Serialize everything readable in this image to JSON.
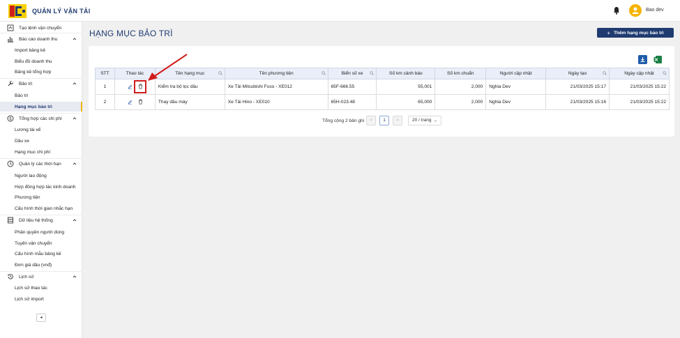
{
  "header": {
    "app_title": "QUẢN LÝ VẬN TẢI",
    "username": "Bao dev"
  },
  "sidebar": {
    "items": [
      {
        "label": "Tạo lệnh vận chuyển"
      },
      {
        "label": "Báo cáo doanh thu"
      },
      {
        "label": "Import bảng kê"
      },
      {
        "label": "Biểu đồ doanh thu"
      },
      {
        "label": "Bảng kê tổng hợp"
      },
      {
        "label": "Bảo trì"
      },
      {
        "label": "Bảo trì"
      },
      {
        "label": "Hạng mục bảo trì"
      },
      {
        "label": "Tổng hợp các chi phí"
      },
      {
        "label": "Lương tài xế"
      },
      {
        "label": "Dầu xe"
      },
      {
        "label": "Hạng mục chi phí"
      },
      {
        "label": "Quản lý các thời hạn"
      },
      {
        "label": "Người lao động"
      },
      {
        "label": "Hợp đồng hợp tác kinh doanh"
      },
      {
        "label": "Phương tiện"
      },
      {
        "label": "Cấu hình thời gian nhắc hạn"
      },
      {
        "label": "Dữ liệu hệ thống"
      },
      {
        "label": "Phân quyền người dùng"
      },
      {
        "label": "Tuyến vận chuyển"
      },
      {
        "label": "Cấu hình mẫu bảng kê"
      },
      {
        "label": "Đơn giá dầu (vnđ)"
      },
      {
        "label": "Lịch sử"
      },
      {
        "label": "Lịch sử thao tác"
      },
      {
        "label": "Lịch sử import"
      }
    ]
  },
  "main": {
    "page_title": "HẠNG MỤC BẢO TRÌ",
    "add_button": "Thêm hạng mục bảo trì",
    "table": {
      "headers": [
        "STT",
        "Thao tác",
        "Tên hạng mục",
        "Tên phương tiện",
        "Biển số xe",
        "Số km cảnh báo",
        "Số km chuẩn",
        "Người cập nhật",
        "Ngày tạo",
        "Ngày cập nhật"
      ],
      "rows": [
        [
          "1",
          "",
          "Kiểm tra bộ lọc dầu",
          "Xe Tải Mitsubishi Fuso - XE012",
          "65F-666.55",
          "55,001",
          "2,000",
          "Nghia Dev",
          "21/03/2025 15:17",
          "21/03/2025 15:22"
        ],
        [
          "2",
          "",
          "Thay dầu máy",
          "Xe Tải Hino - XE010",
          "65H-023.48",
          "65,000",
          "2,000",
          "Nghia Dev",
          "21/03/2025 15:16",
          "21/03/2025 15:22"
        ]
      ]
    },
    "pagination": {
      "total_text": "Tổng cộng 2 bản ghi",
      "prev": "<",
      "page": "1",
      "next": ">",
      "page_size": "20 / trang"
    },
    "collapse_label": "◂"
  }
}
